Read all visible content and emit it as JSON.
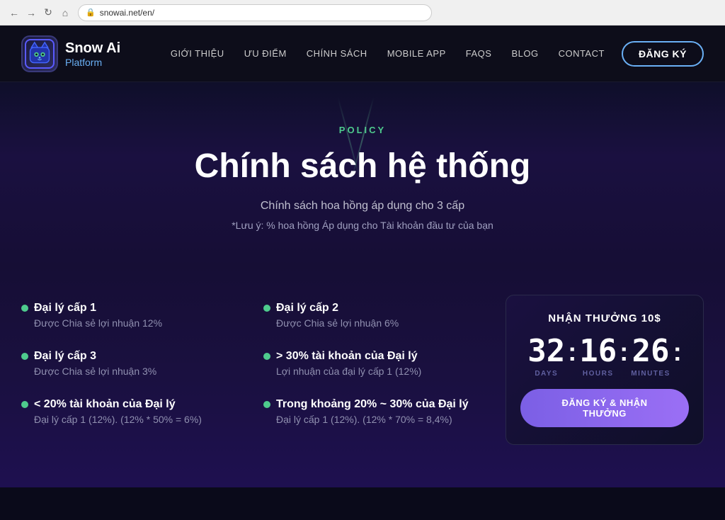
{
  "browser": {
    "url": "snowai.net/en/",
    "lock_symbol": "🔒"
  },
  "navbar": {
    "logo_name": "Snow Ai",
    "logo_sub": "Platform",
    "nav_items": [
      {
        "label": "GIỚI THIỆU",
        "key": "about"
      },
      {
        "label": "ƯU ĐIỂM",
        "key": "advantages"
      },
      {
        "label": "CHÍNH SÁCH",
        "key": "policy"
      },
      {
        "label": "MOBILE APP",
        "key": "mobile"
      },
      {
        "label": "FAQS",
        "key": "faqs"
      },
      {
        "label": "BLOG",
        "key": "blog"
      },
      {
        "label": "CONTACT",
        "key": "contact"
      }
    ],
    "register_btn": "ĐĂNG KÝ"
  },
  "hero": {
    "policy_label": "POLICY",
    "title": "Chính sách hệ thống",
    "subtitle": "Chính sách hoa hồng áp dụng cho 3 cấp",
    "note": "*Lưu ý: % hoa hồng Áp dụng cho Tài khoản đầu tư của bạn"
  },
  "left_items": [
    {
      "title": "Đại lý cấp 1",
      "desc": "Được Chia sẻ lợi nhuận 12%"
    },
    {
      "title": "Đại lý cấp 3",
      "desc": "Được Chia sẻ lợi nhuận 3%"
    },
    {
      "title": "< 20% tài khoản của Đại lý",
      "desc": "Đại lý cấp 1 (12%). (12% * 50% = 6%)"
    }
  ],
  "right_items": [
    {
      "title": "Đại lý cấp 2",
      "desc": "Được Chia sẻ lợi nhuận 6%"
    },
    {
      "title": "> 30% tài khoản của Đại lý",
      "desc": "Lợi nhuận của đại lý cấp 1 (12%)"
    },
    {
      "title": "Trong khoảng 20% ~ 30% của Đại lý",
      "desc": "Đại lý cấp 1 (12%). (12% * 70% = 8,4%)"
    }
  ],
  "countdown": {
    "reward_title": "NHẬN THƯỞNG 10$",
    "days": "32",
    "hours": "16",
    "minutes": "26",
    "days_label": "DAYS",
    "hours_label": "HOURS",
    "minutes_label": "MINUTES",
    "register_btn": "ĐĂNG KÝ & NHẬN THƯỞNG"
  }
}
